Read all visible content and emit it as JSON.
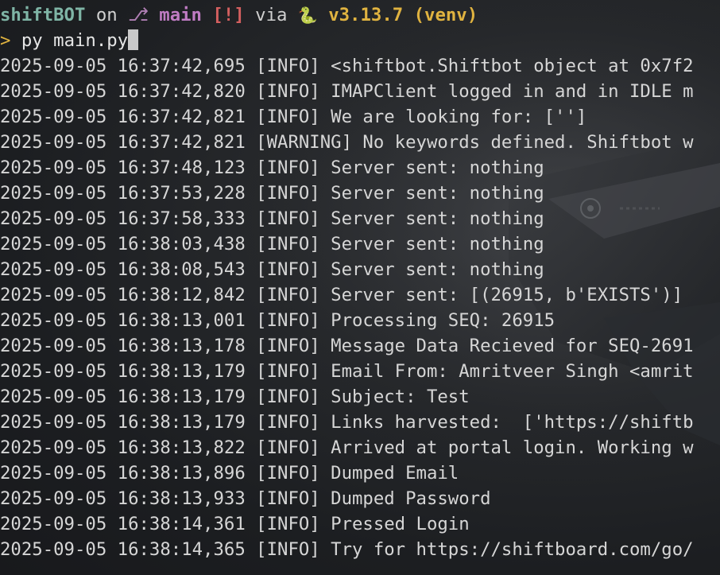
{
  "prompt": {
    "repo": "shiftBOT",
    "on": "on",
    "branch_icon": "",
    "branch": "main",
    "status": "[!]",
    "via": "via",
    "snake": "🐍",
    "version": "v3.13.7 (venv)"
  },
  "command": {
    "arrow": ">",
    "text": "py main.py"
  },
  "log_lines": [
    "2025-09-05 16:37:42,695 [INFO] <shiftbot.Shiftbot object at 0x7f2",
    "2025-09-05 16:37:42,820 [INFO] IMAPClient logged in and in IDLE m",
    "2025-09-05 16:37:42,821 [INFO] We are looking for: ['']",
    "2025-09-05 16:37:42,821 [WARNING] No keywords defined. Shiftbot w",
    "2025-09-05 16:37:48,123 [INFO] Server sent: nothing",
    "2025-09-05 16:37:53,228 [INFO] Server sent: nothing",
    "2025-09-05 16:37:58,333 [INFO] Server sent: nothing",
    "2025-09-05 16:38:03,438 [INFO] Server sent: nothing",
    "2025-09-05 16:38:08,543 [INFO] Server sent: nothing",
    "2025-09-05 16:38:12,842 [INFO] Server sent: [(26915, b'EXISTS')]",
    "2025-09-05 16:38:13,001 [INFO] Processing SEQ: 26915",
    "2025-09-05 16:38:13,178 [INFO] Message Data Recieved for SEQ-2691",
    "2025-09-05 16:38:13,179 [INFO] Email From: Amritveer Singh <amrit",
    "2025-09-05 16:38:13,179 [INFO] Subject: Test",
    "2025-09-05 16:38:13,179 [INFO] Links harvested:  ['https://shiftb",
    "2025-09-05 16:38:13,822 [INFO] Arrived at portal login. Working w",
    "2025-09-05 16:38:13,896 [INFO] Dumped Email",
    "2025-09-05 16:38:13,933 [INFO] Dumped Password",
    "2025-09-05 16:38:14,361 [INFO] Pressed Login",
    "2025-09-05 16:38:14,365 [INFO] Try for https://shiftboard.com/go/"
  ]
}
